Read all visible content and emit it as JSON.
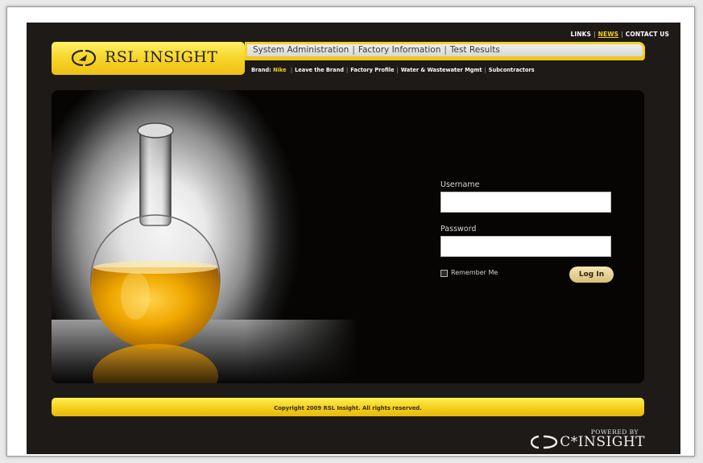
{
  "top_links": {
    "links": "LINKS",
    "news": "NEWS",
    "contact": "CONTACT US",
    "separator": "|"
  },
  "header": {
    "logo_text": "RSL INSIGHT",
    "nav": [
      "System Administration",
      "Factory Information",
      "Test Results"
    ],
    "nav_separator": "|"
  },
  "subnav": {
    "brand_label": "Brand:",
    "brand_value": "Nike",
    "links": [
      "Leave the Brand",
      "Factory Profile",
      "Water & Wastewater Mgmt",
      "Subcontractors"
    ],
    "separator": "|"
  },
  "login": {
    "username_label": "Username",
    "username_value": "",
    "password_label": "Password",
    "password_value": "",
    "remember_label": "Remember Me",
    "remember_checked": false,
    "submit_label": "Log In"
  },
  "footer": {
    "copyright": "Copyright 2009 RSL Insight. All rights reserved.",
    "powered_by": "POWERED BY",
    "powered_brand": "C*INSIGHT"
  },
  "colors": {
    "accent_yellow": "#f4cf1d",
    "background_dark": "#1d1a18",
    "panel_black": "#060504",
    "button_tan": "#d9be78"
  }
}
